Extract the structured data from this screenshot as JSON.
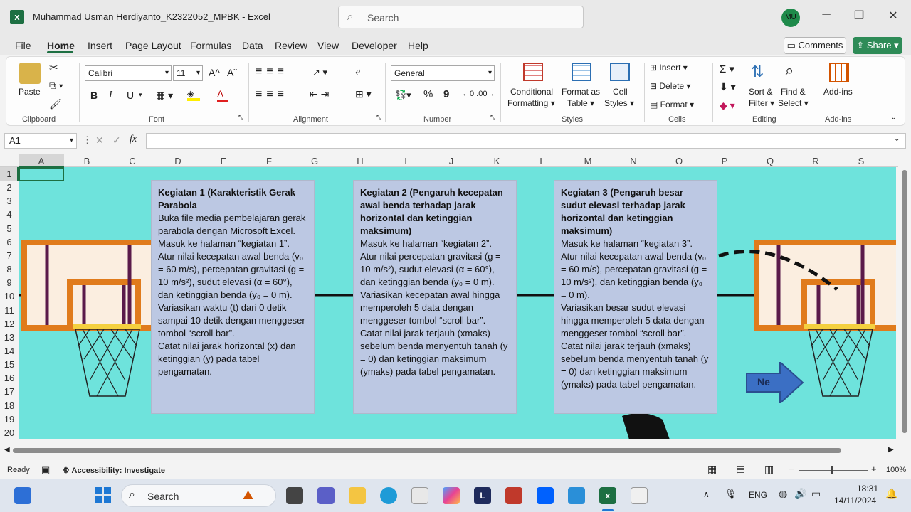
{
  "window": {
    "title": "Muhammad Usman Herdiyanto_K2322052_MPBK  -  Excel",
    "avatar": "MU"
  },
  "search": {
    "placeholder": "Search"
  },
  "menu": [
    "File",
    "Home",
    "Insert",
    "Page Layout",
    "Formulas",
    "Data",
    "Review",
    "View",
    "Developer",
    "Help"
  ],
  "actions": {
    "comments": "Comments",
    "share": "Share"
  },
  "ribbon": {
    "clipboard": {
      "paste": "Paste",
      "label": "Clipboard"
    },
    "font": {
      "name": "Calibri",
      "size": "11",
      "label": "Font",
      "bold": "B",
      "italic": "I",
      "underline": "U",
      "grow": "A^",
      "shrink": "Aˇ"
    },
    "alignment": {
      "label": "Alignment"
    },
    "number": {
      "format": "General",
      "label": "Number",
      "percent": "%",
      "comma": "9"
    },
    "styles": {
      "conditional": "Conditional",
      "formatting": "Formatting",
      "format_as": "Format as",
      "table": "Table",
      "cell": "Cell",
      "cell_styles": "Styles",
      "label": "Styles"
    },
    "cells": {
      "insert": "Insert",
      "delete": "Delete",
      "format": "Format",
      "label": "Cells"
    },
    "editing": {
      "sort": "Sort &",
      "filter": "Filter",
      "find": "Find &",
      "select": "Select",
      "label": "Editing"
    },
    "addins": {
      "name": "Add-ins",
      "label": "Add-ins"
    }
  },
  "formula_bar": {
    "name_box": "A1",
    "fx": "fx"
  },
  "columns": [
    "A",
    "B",
    "C",
    "D",
    "E",
    "F",
    "G",
    "H",
    "I",
    "J",
    "K",
    "L",
    "M",
    "N",
    "O",
    "P",
    "Q",
    "R",
    "S"
  ],
  "rows": [
    "1",
    "2",
    "3",
    "4",
    "5",
    "6",
    "7",
    "8",
    "9",
    "10",
    "11",
    "12",
    "13",
    "14",
    "15",
    "16",
    "17",
    "18",
    "19",
    "20"
  ],
  "boxes": [
    {
      "title": "Kegiatan 1 (Karakteristik Gerak Parabola",
      "body": "Buka file media pembelajaran gerak parabola dengan Microsoft Excel.\nMasuk ke halaman “kegiatan 1”. Atur nilai kecepatan awal benda (v₀ = 60 m/s), percepatan gravitasi (g = 10 m/s²), sudut elevasi (α = 60°), dan ketinggian benda (y₀ = 0 m).\nVariasikan waktu (t) dari 0 detik sampai 10 detik dengan menggeser tombol “scroll bar”.\nCatat nilai jarak horizontal (x) dan ketinggian (y) pada tabel pengamatan."
    },
    {
      "title": "Kegiatan 2 (Pengaruh kecepatan awal benda terhadap jarak horizontal dan ketinggian maksimum)",
      "body": "Masuk ke halaman “kegiatan 2”. Atur nilai percepatan gravitasi (g = 10 m/s²), sudut elevasi (α = 60°), dan ketinggian benda (y₀ = 0 m).\nVariasikan kecepatan awal hingga memperoleh 5 data dengan menggeser tombol “scroll bar”.\nCatat nilai jarak terjauh (xmaks) sebelum benda menyentuh tanah (y = 0) dan ketinggian maksimum (ymaks) pada tabel pengamatan."
    },
    {
      "title": "Kegiatan 3 (Pengaruh besar sudut elevasi terhadap jarak horizontal dan ketinggian maksimum)",
      "body": "Masuk ke halaman “kegiatan 3”. Atur nilai kecepatan awal benda (v₀ = 60 m/s), percepatan gravitasi (g = 10 m/s²), dan ketinggian benda (y₀ = 0 m).\nVariasikan besar sudut elevasi hingga memperoleh 5 data dengan menggeser tombol “scroll bar”.\nCatat nilai jarak terjauh (xmaks) sebelum benda menyentuh tanah (y = 0) dan ketinggian maksimum (ymaks) pada tabel pengamatan."
    }
  ],
  "next_button": "Ne",
  "status": {
    "ready": "Ready",
    "accessibility": "Accessibility: Investigate",
    "zoom": "100%"
  },
  "taskbar": {
    "search": "Search",
    "lang": "ENG",
    "time": "18:31",
    "date": "14/11/2024"
  },
  "colors": {
    "sheet_bg": "#6ee3dc",
    "textbox_bg": "#bcc8e3",
    "excel_green": "#1d6f42",
    "board_orange": "#e07b1c",
    "next_blue": "#3b6fc4"
  }
}
